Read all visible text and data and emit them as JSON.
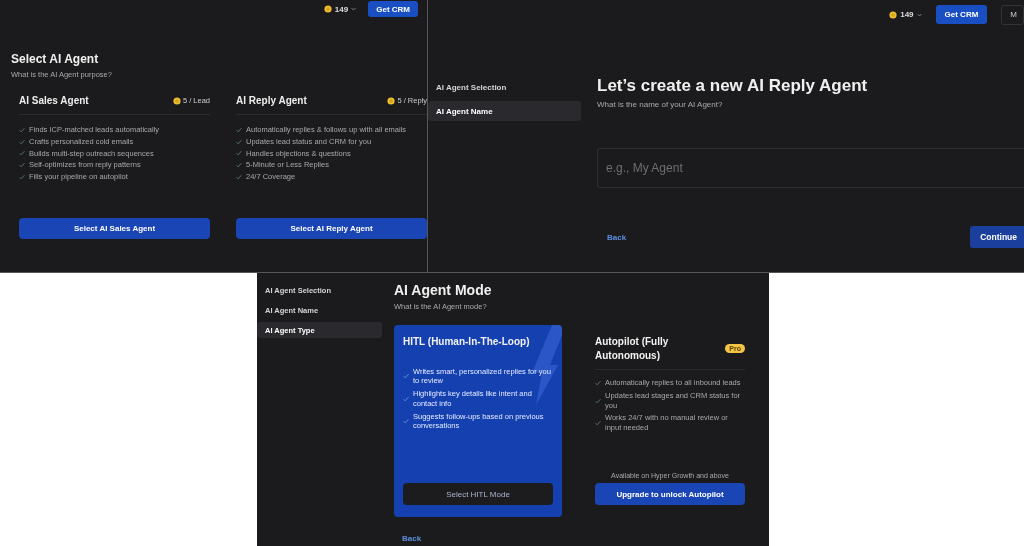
{
  "agent_selection_screen": {
    "header": {
      "credits": "149",
      "button": "Get CRM"
    },
    "title": "Select AI Agent",
    "subtitle": "What is the AI Agent purpose?",
    "agents": [
      {
        "name": "AI Sales Agent",
        "price": "5 / Lead",
        "features": [
          "Finds ICP-matched leads automatically",
          "Crafts personalized cold emails",
          "Builds multi-step outreach sequences",
          "Self-optimizes from reply patterns",
          "Fills your pipeline on autopilot"
        ],
        "button": "Select AI Sales Agent"
      },
      {
        "name": "AI Reply Agent",
        "price": "5 / Reply",
        "features": [
          "Automatically replies & follows up with all emails",
          "Updates lead status and CRM for you",
          "Handles objections & questions",
          "5-Minute or Less Replies",
          "24/7 Coverage"
        ],
        "button": "Select AI Reply Agent"
      }
    ]
  },
  "agent_name_screen": {
    "header": {
      "credits": "149",
      "buttons": [
        "Get CRM",
        "M"
      ]
    },
    "steps": [
      {
        "label": "AI Agent Selection",
        "selected": false
      },
      {
        "label": "AI Agent Name",
        "selected": true
      }
    ],
    "title": "Let’s create a new AI Reply Agent",
    "subtitle": "What is the name of your AI Agent?",
    "name_field": {
      "placeholder": "e.g., My Agent"
    },
    "back": "Back",
    "continue": "Continue"
  },
  "agent_mode_screen": {
    "steps": [
      {
        "label": "AI Agent Selection",
        "selected": false
      },
      {
        "label": "AI Agent Name",
        "selected": false
      },
      {
        "label": "AI Agent Type",
        "selected": true
      }
    ],
    "title": "AI Agent Mode",
    "subtitle": "What is the AI Agent mode?",
    "modes": [
      {
        "name": "HITL (Human-In-The-Loop)",
        "selected": true,
        "features": [
          "Writes smart, personalized replies for you to review",
          "Highlights key details like intent and contact info",
          "Suggests follow-ups based on previous conversations"
        ],
        "button": "Select HITL Mode"
      },
      {
        "name": "Autopilot (Fully Autonomous)",
        "selected": false,
        "badge": "Pro",
        "features": [
          "Automatically replies to all inbound leads",
          "Updates lead stages and CRM status for you",
          "Works 24/7 with no manual review or input needed"
        ],
        "note": "Available on Hyper Growth and above",
        "button": "Upgrade to unlock Autopilot"
      }
    ],
    "back": "Back"
  }
}
